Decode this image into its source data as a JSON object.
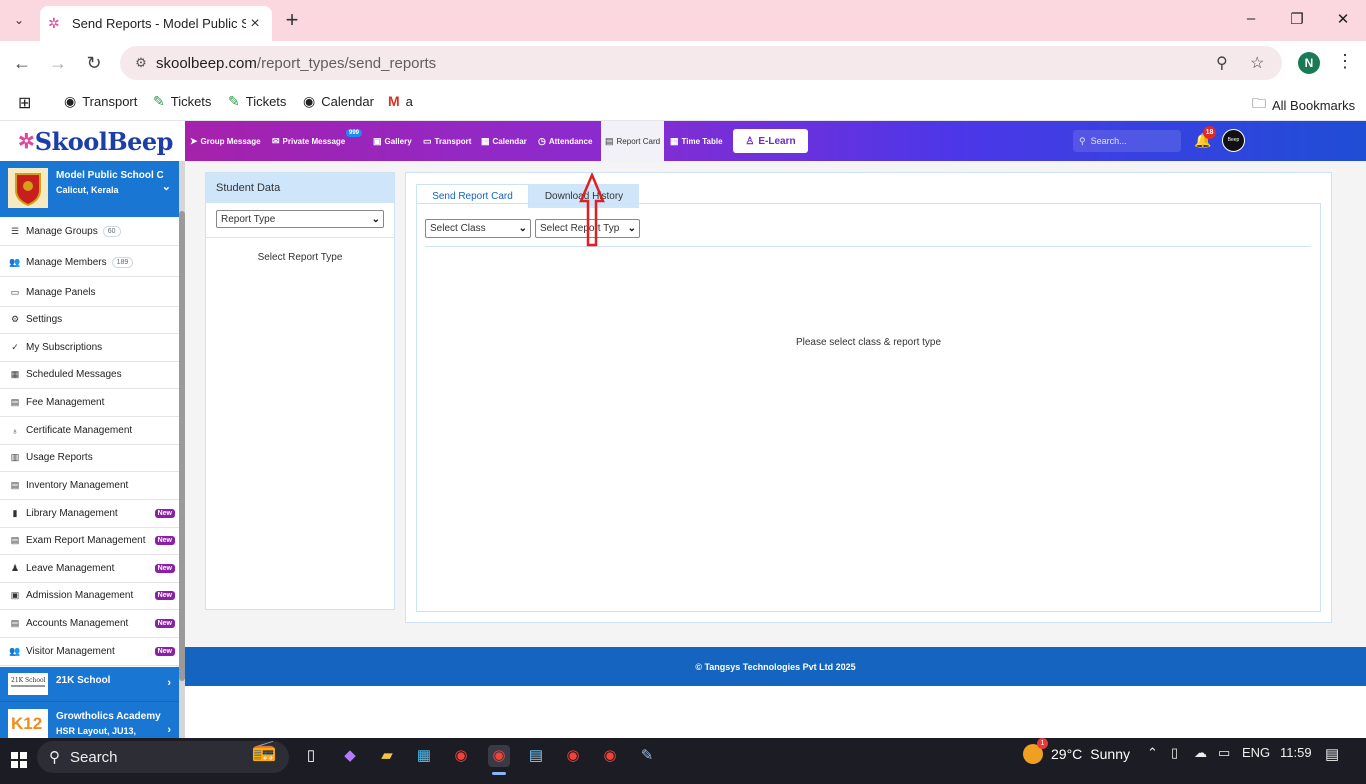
{
  "browser": {
    "tab_title": "Send Reports - Model Public Sc",
    "url_host": "skoolbeep.com",
    "url_path": "/report_types/send_reports",
    "profile_initial": "N",
    "bookmarks": [
      {
        "label": "Transport",
        "icon": "globe-icon"
      },
      {
        "label": "Tickets",
        "icon": "tickets-icon"
      },
      {
        "label": "Tickets",
        "icon": "tickets-icon"
      },
      {
        "label": "Calendar",
        "icon": "globe-icon"
      },
      {
        "label": "a",
        "icon": "gmail-icon"
      }
    ],
    "all_bookmarks": "All Bookmarks"
  },
  "app": {
    "brand": "SkoolBeep",
    "nav": [
      {
        "label": "Group Message",
        "icon": "send-icon"
      },
      {
        "label": "Private Message",
        "icon": "mail-icon",
        "badge": "999"
      },
      {
        "label": "Gallery",
        "icon": "image-icon"
      },
      {
        "label": "Transport",
        "icon": "bus-icon"
      },
      {
        "label": "Calendar",
        "icon": "calendar-icon"
      },
      {
        "label": "Attendance",
        "icon": "clock-icon"
      },
      {
        "label": "Report Card",
        "icon": "document-icon",
        "active": true
      },
      {
        "label": "Time Table",
        "icon": "calendar-icon"
      }
    ],
    "elearn": "E-Learn",
    "search_placeholder": "Search...",
    "notification_count": "18",
    "avatar_text": "Beep"
  },
  "sidebar": {
    "school": {
      "name": "Model Public School C",
      "location": "Calicut, Kerala"
    },
    "items": [
      {
        "label": "Manage Groups",
        "count": "60",
        "icon": "list-icon"
      },
      {
        "label": "Manage Members",
        "count": "189",
        "icon": "users-icon"
      },
      {
        "label": "Manage Panels",
        "icon": "monitor-icon"
      },
      {
        "label": "Settings",
        "icon": "gear-icon"
      },
      {
        "label": "My Subscriptions",
        "icon": "check-icon"
      },
      {
        "label": "Scheduled Messages",
        "icon": "calendar-icon"
      },
      {
        "label": "Fee Management",
        "icon": "document-icon"
      },
      {
        "label": "Certificate Management",
        "icon": "award-icon"
      },
      {
        "label": "Usage Reports",
        "icon": "bar-chart-icon"
      },
      {
        "label": "Inventory Management",
        "icon": "box-icon"
      },
      {
        "label": "Library Management",
        "icon": "book-icon",
        "new": "New"
      },
      {
        "label": "Exam Report Management",
        "icon": "document-icon",
        "new": "New"
      },
      {
        "label": "Leave Management",
        "icon": "user-minus-icon",
        "new": "New"
      },
      {
        "label": "Admission Management",
        "icon": "id-card-icon",
        "new": "New"
      },
      {
        "label": "Accounts Management",
        "icon": "document-icon",
        "new": "New"
      },
      {
        "label": "Visitor Management",
        "icon": "users-icon",
        "new": "New"
      }
    ],
    "other_schools": [
      {
        "name": "21K School",
        "location": ""
      },
      {
        "name": "Growtholics Academy",
        "location": "HSR Layout, JU13,"
      }
    ]
  },
  "student_panel": {
    "title": "Student Data",
    "report_type_select": "Report Type",
    "message": "Select Report Type"
  },
  "report_panel": {
    "tabs": [
      "Send Report Card",
      "Download History"
    ],
    "class_select": "Select Class",
    "report_type_select": "Select Report Typ",
    "message": "Please select class & report type"
  },
  "footer": "© Tangsys Technologies Pvt Ltd 2025",
  "taskbar": {
    "search": "Search",
    "weather_alert": "1",
    "temperature": "29°C",
    "condition": "Sunny",
    "language": "ENG",
    "time": "11:59"
  },
  "colors": {
    "brand_blue": "#1565c0",
    "header_gradient_start": "#b21d9c",
    "header_gradient_end": "#1f4dd6",
    "new_badge": "#8b1fa8",
    "annotation_arrow": "#e02020"
  }
}
